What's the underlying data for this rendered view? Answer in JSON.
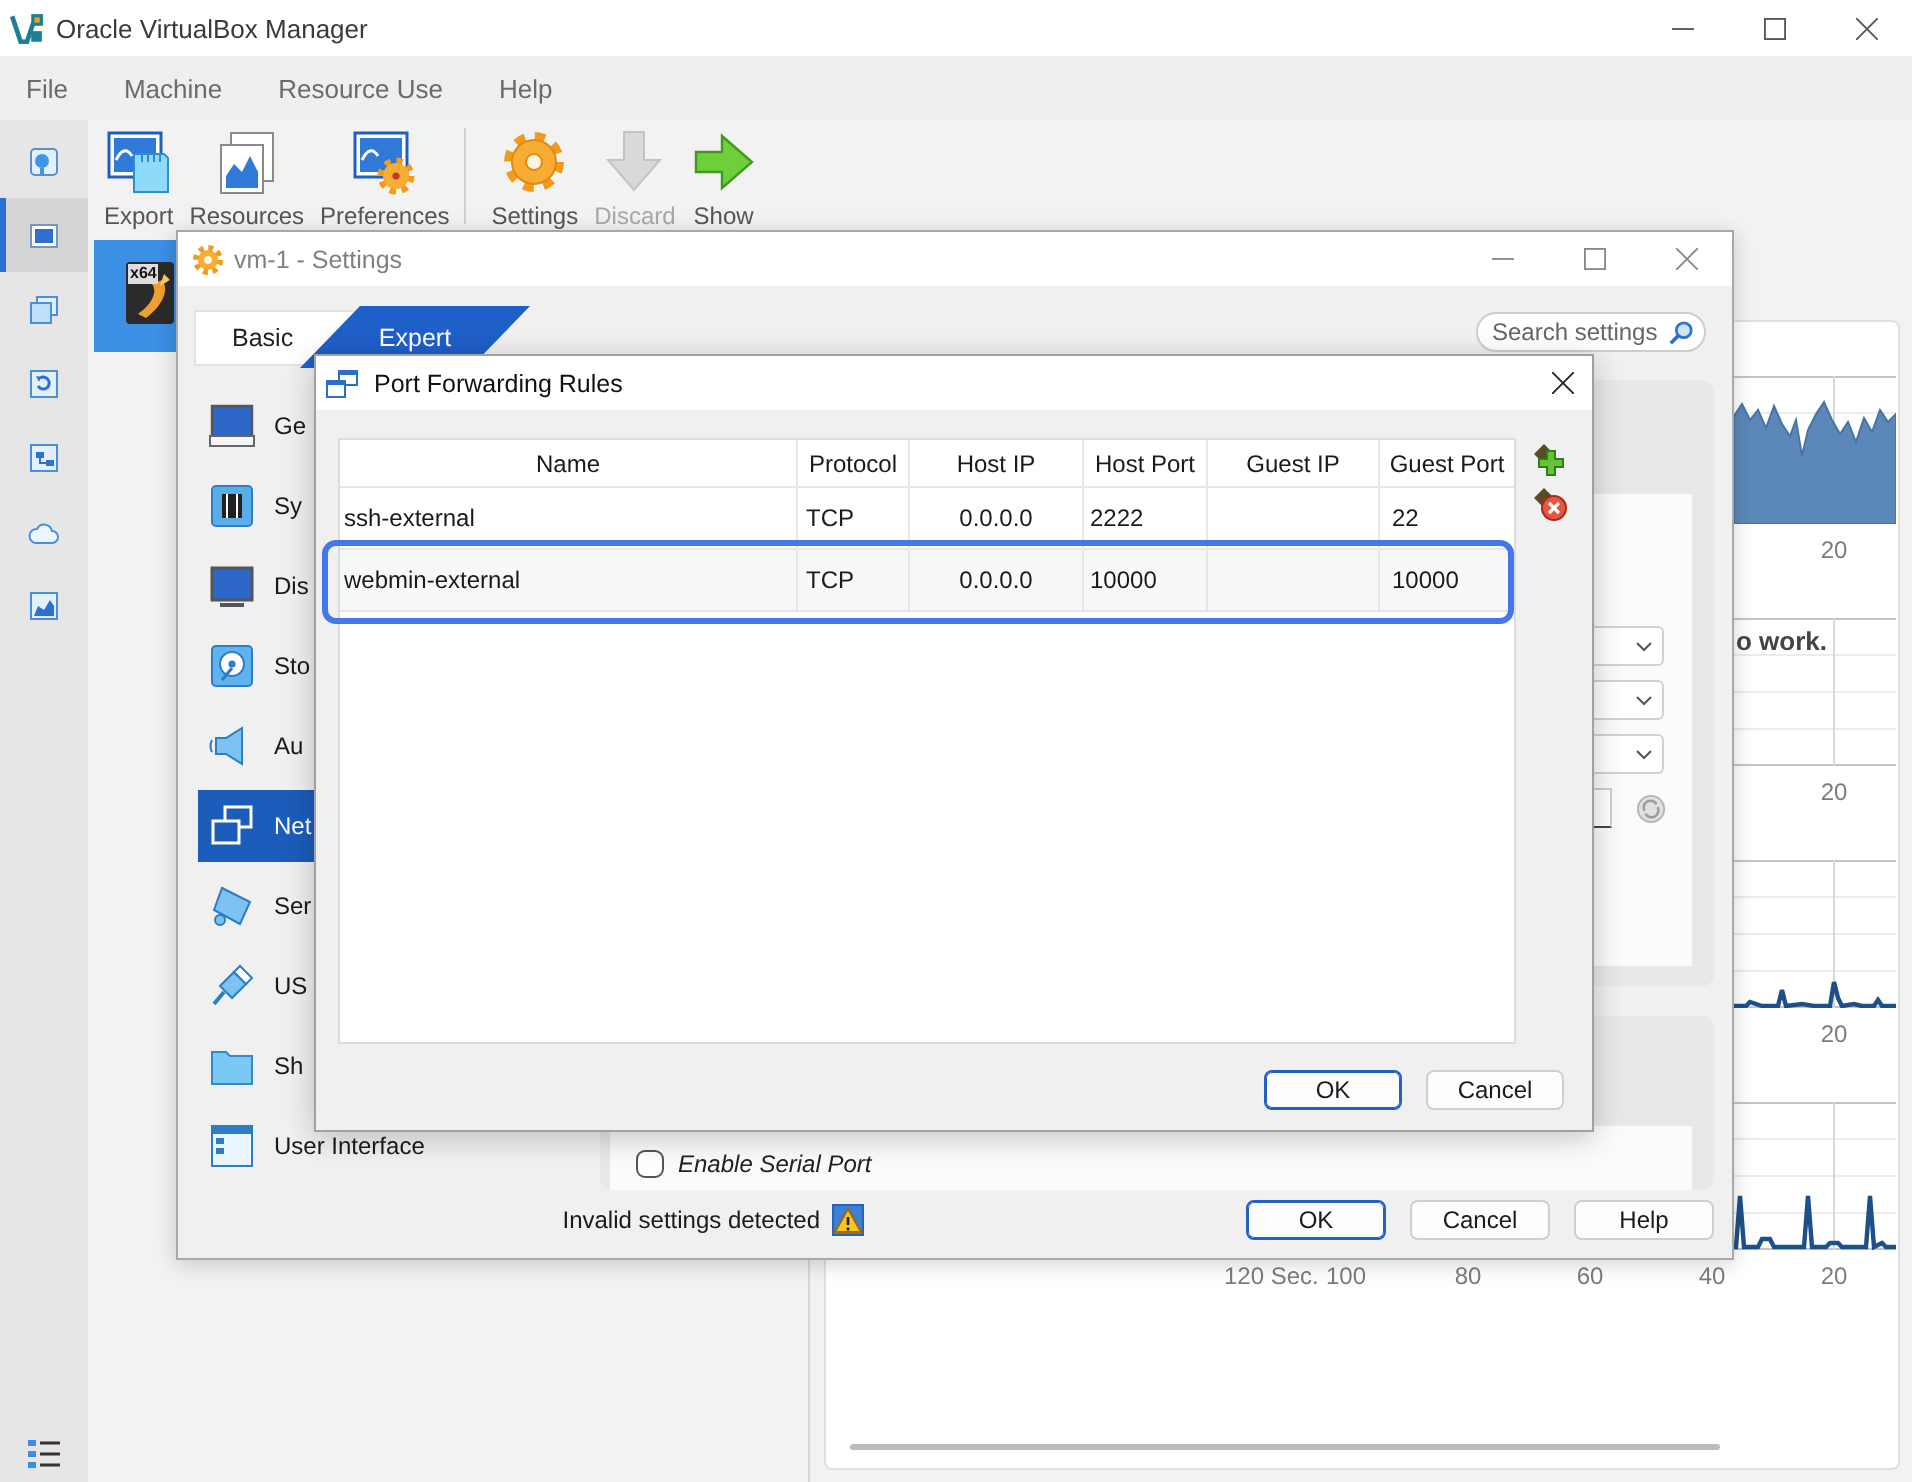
{
  "window": {
    "title": "Oracle VirtualBox Manager"
  },
  "menu": [
    "File",
    "Machine",
    "Resource Use",
    "Help"
  ],
  "tool_strip": [
    {
      "selected": false
    },
    {
      "selected": true
    },
    {
      "selected": false
    },
    {
      "selected": false
    },
    {
      "selected": false
    },
    {
      "selected": false
    },
    {
      "selected": false
    }
  ],
  "toolbar_groups": [
    {
      "buttons": [
        {
          "label": "Export",
          "disabled": false
        },
        {
          "label": "Resources",
          "disabled": false
        },
        {
          "label": "Preferences",
          "disabled": false
        }
      ]
    },
    {
      "buttons": [
        {
          "label": "Settings",
          "disabled": false
        },
        {
          "label": "Discard",
          "disabled": true
        },
        {
          "label": "Show",
          "disabled": false
        }
      ]
    }
  ],
  "vm_list": [
    {
      "os_badge": "x64",
      "selected": true
    }
  ],
  "resource_charts": [
    {
      "kind": "area",
      "x_ticks": [
        "20"
      ]
    },
    {
      "kind": "empty",
      "message": "o work.",
      "x_ticks": [
        "20"
      ]
    },
    {
      "kind": "line",
      "x_ticks": [
        "20"
      ]
    },
    {
      "kind": "line",
      "x_ticks": [
        "120 Sec.",
        "100",
        "80",
        "60",
        "40",
        "20"
      ]
    }
  ],
  "settings_dialog": {
    "title": "vm-1 - Settings",
    "modes": [
      {
        "label": "Basic",
        "selected": false
      },
      {
        "label": "Expert",
        "selected": true
      }
    ],
    "search": {
      "placeholder": "Search settings"
    },
    "nav": [
      {
        "label": "Ge",
        "selected": false
      },
      {
        "label": "Sy",
        "selected": false
      },
      {
        "label": "Dis",
        "selected": false
      },
      {
        "label": "Sto",
        "selected": false
      },
      {
        "label": "Au",
        "selected": false
      },
      {
        "label": "Net",
        "selected": true
      },
      {
        "label": "Ser",
        "selected": false
      },
      {
        "label": "US",
        "selected": false
      },
      {
        "label": "Sh",
        "selected": false
      },
      {
        "label": "User Interface",
        "selected": false
      }
    ],
    "serial_port_checkbox": {
      "label": "Enable Serial Port",
      "checked": false
    },
    "status": "Invalid settings detected",
    "buttons": [
      {
        "label": "OK",
        "default": true
      },
      {
        "label": "Cancel",
        "default": false
      },
      {
        "label": "Help",
        "default": false
      }
    ]
  },
  "port_forwarding_dialog": {
    "title": "Port Forwarding Rules",
    "columns": [
      "Name",
      "Protocol",
      "Host IP",
      "Host Port",
      "Guest IP",
      "Guest Port"
    ],
    "rows": [
      {
        "name": "ssh-external",
        "protocol": "TCP",
        "host_ip": "0.0.0.0",
        "host_port": "2222",
        "guest_port": "22",
        "highlighted": false
      },
      {
        "name": "webmin-external",
        "protocol": "TCP",
        "host_ip": "0.0.0.0",
        "host_port": "10000",
        "guest_port": "10000",
        "highlighted": true
      }
    ],
    "buttons": [
      {
        "label": "OK",
        "default": true
      },
      {
        "label": "Cancel",
        "default": false
      }
    ]
  }
}
